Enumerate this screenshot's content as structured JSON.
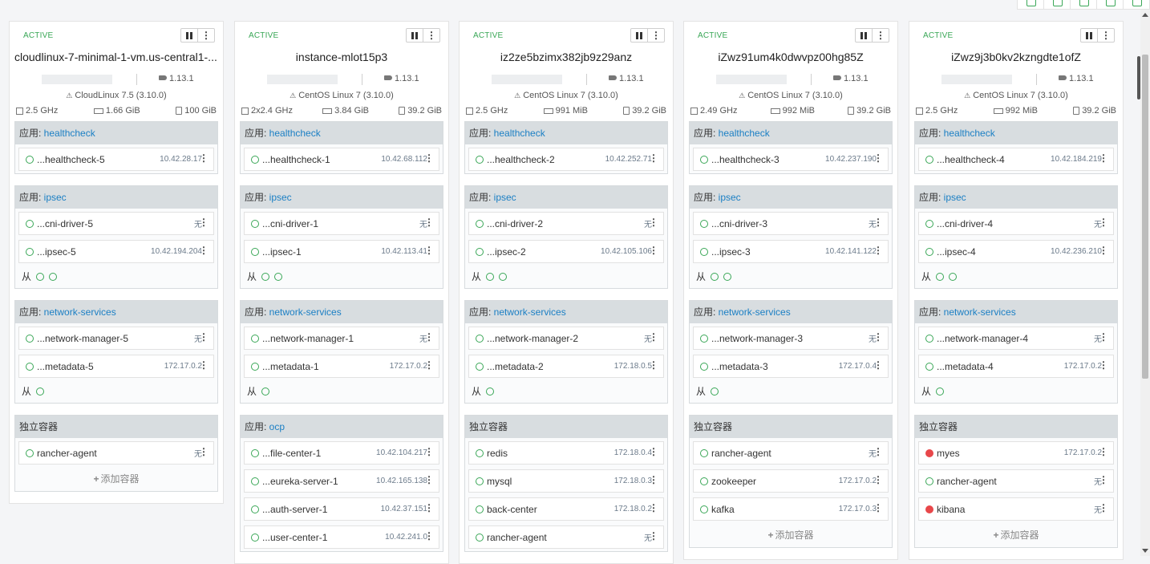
{
  "sidekick_label": "从",
  "add_container_label": "添加容器",
  "hosts": [
    {
      "state": "ACTIVE",
      "name": "cloudlinux-7-minimal-1-vm.us-central1-...",
      "docker_version": "1.13.1",
      "os": "CloudLinux 7.5 (3.10.0)",
      "cpu": "2.5 GHz",
      "ram": "1.66 GiB",
      "disk": "100 GiB",
      "stacks": [
        {
          "prefix": "应用: ",
          "name": "healthcheck",
          "containers": [
            {
              "name": "...healthcheck-5",
              "ip": "10.42.28.17",
              "state": "ok"
            }
          ],
          "sidekicks": 0
        },
        {
          "prefix": "应用: ",
          "name": "ipsec",
          "containers": [
            {
              "name": "...cni-driver-5",
              "ip": "无",
              "state": "ok"
            },
            {
              "name": "...ipsec-5",
              "ip": "10.42.194.204",
              "state": "ok"
            }
          ],
          "sidekicks": 2
        },
        {
          "prefix": "应用: ",
          "name": "network-services",
          "containers": [
            {
              "name": "...network-manager-5",
              "ip": "无",
              "state": "ok"
            },
            {
              "name": "...metadata-5",
              "ip": "172.17.0.2",
              "state": "ok"
            }
          ],
          "sidekicks": 1
        },
        {
          "prefix": "独立容器",
          "name": "",
          "containers": [
            {
              "name": "rancher-agent",
              "ip": "无",
              "state": "ok"
            }
          ],
          "sidekicks": 0,
          "add": true
        }
      ]
    },
    {
      "state": "ACTIVE",
      "name": "instance-mlot15p3",
      "docker_version": "1.13.1",
      "os": "CentOS Linux 7 (3.10.0)",
      "cpu": "2x2.4 GHz",
      "ram": "3.84 GiB",
      "disk": "39.2 GiB",
      "stacks": [
        {
          "prefix": "应用: ",
          "name": "healthcheck",
          "containers": [
            {
              "name": "...healthcheck-1",
              "ip": "10.42.68.112",
              "state": "ok"
            }
          ],
          "sidekicks": 0
        },
        {
          "prefix": "应用: ",
          "name": "ipsec",
          "containers": [
            {
              "name": "...cni-driver-1",
              "ip": "无",
              "state": "ok"
            },
            {
              "name": "...ipsec-1",
              "ip": "10.42.113.41",
              "state": "ok"
            }
          ],
          "sidekicks": 2
        },
        {
          "prefix": "应用: ",
          "name": "network-services",
          "containers": [
            {
              "name": "...network-manager-1",
              "ip": "无",
              "state": "ok"
            },
            {
              "name": "...metadata-1",
              "ip": "172.17.0.2",
              "state": "ok"
            }
          ],
          "sidekicks": 1
        },
        {
          "prefix": "应用: ",
          "name": "ocp",
          "containers": [
            {
              "name": "...file-center-1",
              "ip": "10.42.104.217",
              "state": "ok"
            },
            {
              "name": "...eureka-server-1",
              "ip": "10.42.165.138",
              "state": "ok"
            },
            {
              "name": "...auth-server-1",
              "ip": "10.42.37.151",
              "state": "ok"
            },
            {
              "name": "...user-center-1",
              "ip": "10.42.241.0",
              "state": "ok"
            }
          ],
          "sidekicks": 0
        }
      ]
    },
    {
      "state": "ACTIVE",
      "name": "iz2ze5bzimx382jb9z29anz",
      "docker_version": "1.13.1",
      "os": "CentOS Linux 7 (3.10.0)",
      "cpu": "2.5 GHz",
      "ram": "991 MiB",
      "disk": "39.2 GiB",
      "stacks": [
        {
          "prefix": "应用: ",
          "name": "healthcheck",
          "containers": [
            {
              "name": "...healthcheck-2",
              "ip": "10.42.252.71",
              "state": "ok"
            }
          ],
          "sidekicks": 0
        },
        {
          "prefix": "应用: ",
          "name": "ipsec",
          "containers": [
            {
              "name": "...cni-driver-2",
              "ip": "无",
              "state": "ok"
            },
            {
              "name": "...ipsec-2",
              "ip": "10.42.105.106",
              "state": "ok"
            }
          ],
          "sidekicks": 2
        },
        {
          "prefix": "应用: ",
          "name": "network-services",
          "containers": [
            {
              "name": "...network-manager-2",
              "ip": "无",
              "state": "ok"
            },
            {
              "name": "...metadata-2",
              "ip": "172.18.0.5",
              "state": "ok"
            }
          ],
          "sidekicks": 1
        },
        {
          "prefix": "独立容器",
          "name": "",
          "containers": [
            {
              "name": "redis",
              "ip": "172.18.0.4",
              "state": "ok"
            },
            {
              "name": "mysql",
              "ip": "172.18.0.3",
              "state": "ok"
            },
            {
              "name": "back-center",
              "ip": "172.18.0.2",
              "state": "ok"
            },
            {
              "name": "rancher-agent",
              "ip": "无",
              "state": "ok"
            }
          ],
          "sidekicks": 0
        }
      ]
    },
    {
      "state": "ACTIVE",
      "name": "iZwz91um4k0dwvpz00hg85Z",
      "docker_version": "1.13.1",
      "os": "CentOS Linux 7 (3.10.0)",
      "cpu": "2.49 GHz",
      "ram": "992 MiB",
      "disk": "39.2 GiB",
      "stacks": [
        {
          "prefix": "应用: ",
          "name": "healthcheck",
          "containers": [
            {
              "name": "...healthcheck-3",
              "ip": "10.42.237.190",
              "state": "ok"
            }
          ],
          "sidekicks": 0
        },
        {
          "prefix": "应用: ",
          "name": "ipsec",
          "containers": [
            {
              "name": "...cni-driver-3",
              "ip": "无",
              "state": "ok"
            },
            {
              "name": "...ipsec-3",
              "ip": "10.42.141.122",
              "state": "ok"
            }
          ],
          "sidekicks": 2
        },
        {
          "prefix": "应用: ",
          "name": "network-services",
          "containers": [
            {
              "name": "...network-manager-3",
              "ip": "无",
              "state": "ok"
            },
            {
              "name": "...metadata-3",
              "ip": "172.17.0.4",
              "state": "ok"
            }
          ],
          "sidekicks": 1
        },
        {
          "prefix": "独立容器",
          "name": "",
          "containers": [
            {
              "name": "rancher-agent",
              "ip": "无",
              "state": "ok"
            },
            {
              "name": "zookeeper",
              "ip": "172.17.0.2",
              "state": "ok"
            },
            {
              "name": "kafka",
              "ip": "172.17.0.3",
              "state": "ok"
            }
          ],
          "sidekicks": 0,
          "add": true
        }
      ]
    },
    {
      "state": "ACTIVE",
      "name": "iZwz9j3b0kv2kzngdte1ofZ",
      "docker_version": "1.13.1",
      "os": "CentOS Linux 7 (3.10.0)",
      "cpu": "2.5 GHz",
      "ram": "992 MiB",
      "disk": "39.2 GiB",
      "stacks": [
        {
          "prefix": "应用: ",
          "name": "healthcheck",
          "containers": [
            {
              "name": "...healthcheck-4",
              "ip": "10.42.184.219",
              "state": "ok"
            }
          ],
          "sidekicks": 0
        },
        {
          "prefix": "应用: ",
          "name": "ipsec",
          "containers": [
            {
              "name": "...cni-driver-4",
              "ip": "无",
              "state": "ok"
            },
            {
              "name": "...ipsec-4",
              "ip": "10.42.236.210",
              "state": "ok"
            }
          ],
          "sidekicks": 2
        },
        {
          "prefix": "应用: ",
          "name": "network-services",
          "containers": [
            {
              "name": "...network-manager-4",
              "ip": "无",
              "state": "ok"
            },
            {
              "name": "...metadata-4",
              "ip": "172.17.0.2",
              "state": "ok"
            }
          ],
          "sidekicks": 1
        },
        {
          "prefix": "独立容器",
          "name": "",
          "containers": [
            {
              "name": "myes",
              "ip": "172.17.0.2",
              "state": "error"
            },
            {
              "name": "rancher-agent",
              "ip": "无",
              "state": "ok"
            },
            {
              "name": "kibana",
              "ip": "无",
              "state": "error"
            }
          ],
          "sidekicks": 0,
          "add": true
        }
      ]
    }
  ],
  "colors": {
    "active": "#3aa757",
    "link": "#1b7fc4",
    "error": "#e8474a"
  }
}
